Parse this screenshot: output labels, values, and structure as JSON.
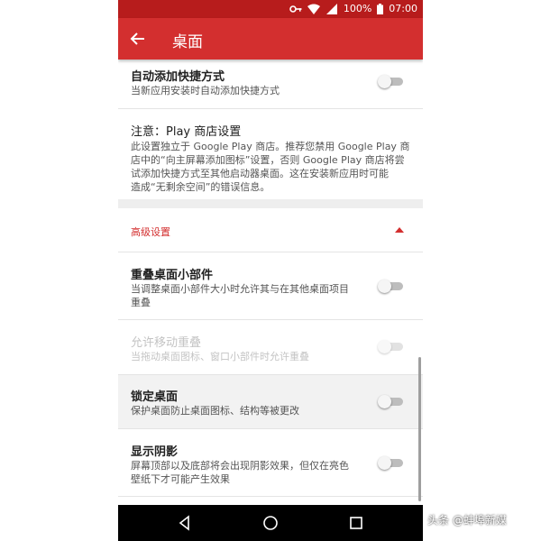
{
  "statusbar": {
    "battery": "100%",
    "time": "07:00"
  },
  "appbar": {
    "title": "桌面"
  },
  "settings": {
    "auto_add": {
      "title": "自动添加快捷方式",
      "subtitle": "当新应用安装时自动添加快捷方式"
    },
    "note": {
      "title": "注意：Play 商店设置",
      "body1": "此设置独立于 Google Play 商店。推荐您禁用 Google Play 商",
      "body2": "店中的“向主屏幕添加图标”设置，否则 Google Play 商店将尝",
      "body3": "试添加快捷方式至其他启动器桌面。这在安装新应用时可能",
      "body4": "造成“无剩余空间”的错误信息。"
    },
    "advanced_header": "高级设置",
    "overlap_widgets": {
      "title": "重叠桌面小部件",
      "subtitle1": "当调整桌面小部件大小时允许其与在其他桌面项目",
      "subtitle2": "重叠"
    },
    "allow_move_overlap": {
      "title": "允许移动重叠",
      "subtitle": "当拖动桌面图标、窗口小部件时允许重叠"
    },
    "lock_desktop": {
      "title": "锁定桌面",
      "subtitle": "保护桌面防止桌面图标、结构等被更改"
    },
    "show_shadow": {
      "title": "显示阴影",
      "subtitle1": "屏幕顶部以及底部将会出现阴影效果，但仅在亮色",
      "subtitle2": "壁纸下才可能产生效果"
    }
  },
  "watermark": "头条 @蚌埠新媒",
  "colors": {
    "appbar": "#d32f2f",
    "statusbar": "#b71c1c",
    "accent": "#d32f2f"
  },
  "icons": [
    "key-icon",
    "wifi-icon",
    "signal-icon",
    "battery-icon",
    "back-arrow-icon",
    "collapse-arrow-icon",
    "nav-back-icon",
    "nav-home-icon",
    "nav-recents-icon"
  ]
}
